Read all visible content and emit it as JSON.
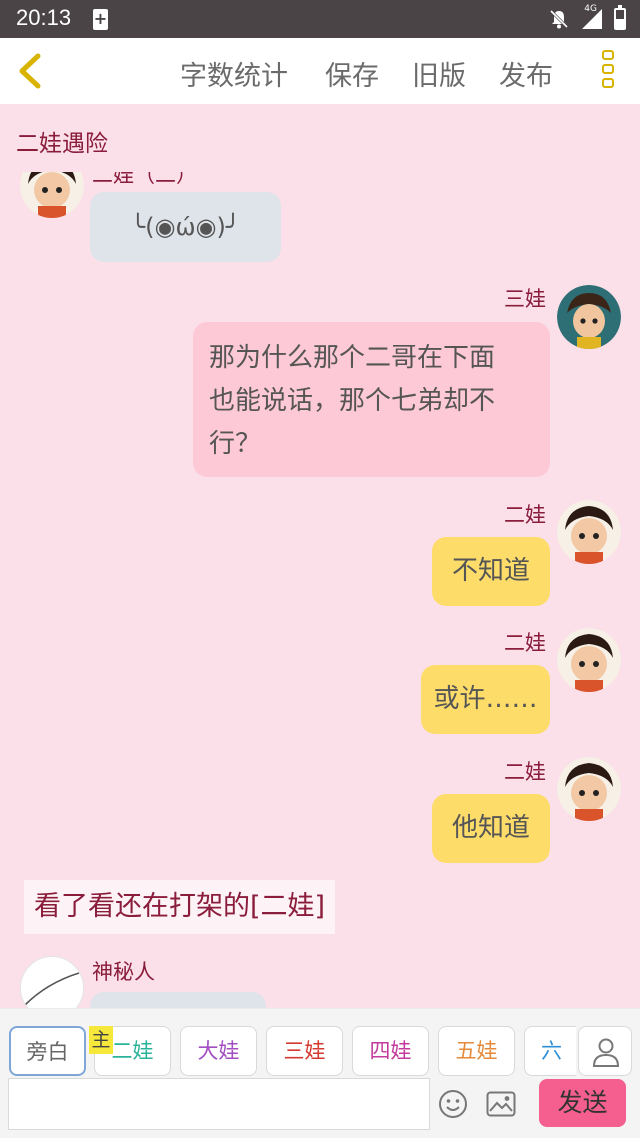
{
  "status_bar": {
    "time": "20:13",
    "battery_plus": "+",
    "network": "4G"
  },
  "toolbar": {
    "word_count": "字数统计",
    "save": "保存",
    "old_version": "旧版",
    "publish": "发布"
  },
  "chapter_title": "二娃遇险",
  "messages": [
    {
      "speaker": "二娃（二）",
      "text": "╰(◉ώ◉)╯",
      "side": "left",
      "style": "gray"
    },
    {
      "speaker": "三娃",
      "text_lines": [
        "那为什么那个二哥在下面",
        "也能说话，那个七弟却不",
        "行？"
      ],
      "side": "right",
      "style": "pink"
    },
    {
      "speaker": "二娃",
      "text": "不知道",
      "side": "right",
      "style": "yellow"
    },
    {
      "speaker": "二娃",
      "text": "或许……",
      "side": "right",
      "style": "yellow"
    },
    {
      "speaker": "二娃",
      "text": "他知道",
      "side": "right",
      "style": "yellow"
    },
    {
      "speaker": "",
      "text": "",
      "side": "left",
      "style": "gray"
    }
  ],
  "narration": "看了看还在打架的[二娃]",
  "last_speaker": "神秘人",
  "characters": [
    {
      "label": "旁白",
      "color": "#666666",
      "active": true
    },
    {
      "label": "二娃",
      "color": "#2bb39a",
      "active": false
    },
    {
      "label": "大娃",
      "color": "#a34fc2",
      "active": false
    },
    {
      "label": "三娃",
      "color": "#d43a2f",
      "active": false
    },
    {
      "label": "四娃",
      "color": "#c23b9c",
      "active": false
    },
    {
      "label": "五娃",
      "color": "#e58a3a",
      "active": false
    },
    {
      "label": "六娃",
      "color": "#2f8fd4",
      "active": false
    }
  ],
  "main_badge": "主",
  "input": {
    "value": "",
    "placeholder": ""
  },
  "send_label": "发送",
  "colors": {
    "accent": "#f45f8f",
    "name": "#8a1c3c",
    "background": "#fbe0e9",
    "icon_yellow": "#d8b400"
  },
  "icons": [
    "back-chevron-icon",
    "more-menu-icon",
    "mute-icon",
    "signal-icon",
    "battery-icon",
    "user-icon",
    "emoji-icon",
    "image-icon"
  ]
}
